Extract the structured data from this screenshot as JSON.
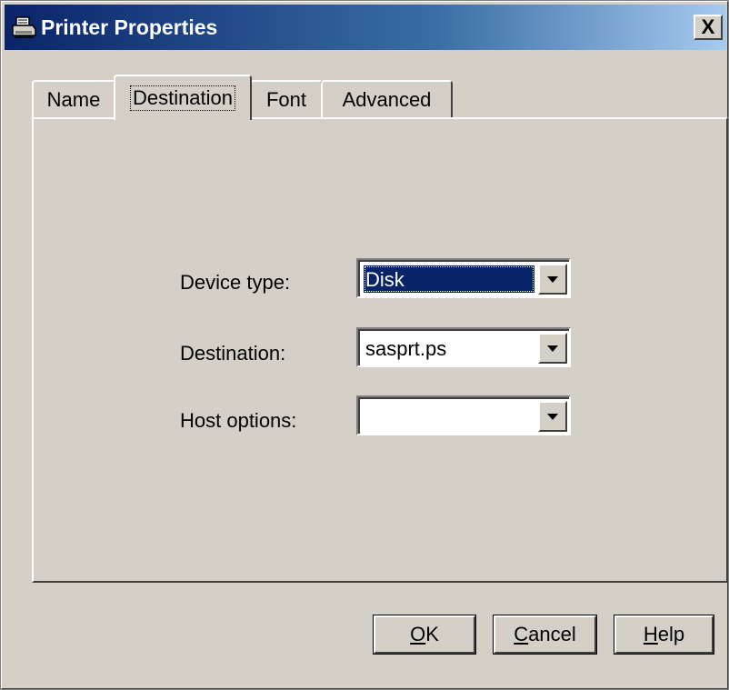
{
  "window": {
    "title": "Printer Properties",
    "close_label": "X"
  },
  "tabs": [
    {
      "label": "Name",
      "active": false
    },
    {
      "label": "Destination",
      "active": true
    },
    {
      "label": "Font",
      "active": false
    },
    {
      "label": "Advanced",
      "active": false
    }
  ],
  "fields": {
    "device_type": {
      "label": "Device type:",
      "value": "Disk"
    },
    "destination": {
      "label": "Destination:",
      "value": "sasprt.ps"
    },
    "host_options": {
      "label": "Host options:",
      "value": ""
    }
  },
  "buttons": {
    "ok": {
      "accel": "O",
      "rest": "K"
    },
    "cancel": {
      "accel": "C",
      "rest": "ancel"
    },
    "help": {
      "accel": "H",
      "rest": "elp"
    }
  },
  "colors": {
    "title_start": "#0a246a",
    "title_end": "#a6caf0",
    "face": "#d4d0c8",
    "selection": "#0a246a"
  },
  "icons": {
    "title": "printer-icon",
    "close": "close-icon",
    "dropdown": "dropdown-arrow-icon"
  }
}
